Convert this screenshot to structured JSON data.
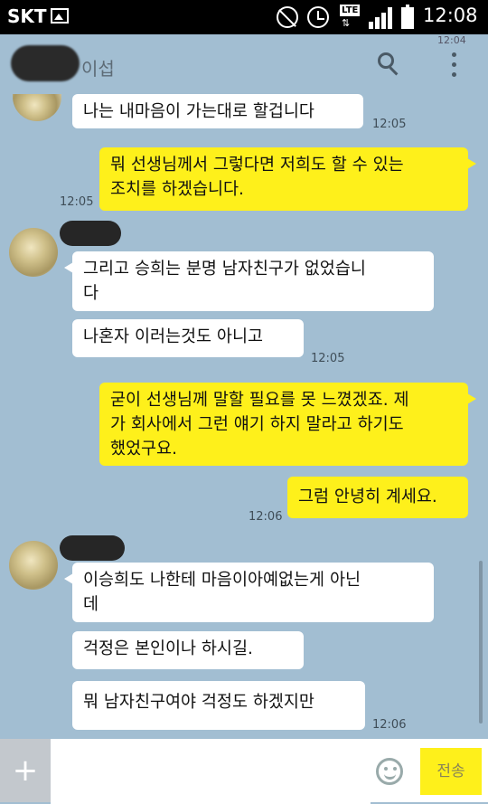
{
  "status_bar": {
    "carrier": "SKT",
    "network": "LTE",
    "time": "12:08"
  },
  "header": {
    "title_partial": "이섭",
    "time_partial": "12:04"
  },
  "messages": [
    {
      "side": "left",
      "text": "나는 내마음이 가는대로 할겁니다",
      "time": "12:05"
    },
    {
      "side": "right",
      "text": "뭐 선생님께서 그렇다면 저희도 할 수 있는\n조치를 하겠습니다.",
      "time": "12:05"
    },
    {
      "side": "left",
      "text": "그리고 승희는 분명 남자친구가 없었습니\n다"
    },
    {
      "side": "left",
      "text": "나혼자 이러는것도 아니고",
      "time": "12:05"
    },
    {
      "side": "right",
      "text": "굳이 선생님께 말할 필요를 못 느꼈겠죠. 제\n가 회사에서 그런 얘기 하지 말라고 하기도\n했었구요."
    },
    {
      "side": "right",
      "text": "그럼 안녕히 계세요.",
      "time": "12:06"
    },
    {
      "side": "left",
      "text": "이승희도 나한테 마음이아예없는게 아닌\n데"
    },
    {
      "side": "left",
      "text": "걱정은 본인이나 하시길."
    },
    {
      "side": "left",
      "text": "뭐 남자친구여야 걱정도 하겠지만",
      "time": "12:06"
    }
  ],
  "input_bar": {
    "plus_label": "+",
    "placeholder": "",
    "send_label": "전송"
  },
  "colors": {
    "background": "#a2bed2",
    "my_bubble": "#fef01b",
    "their_bubble": "#ffffff"
  }
}
